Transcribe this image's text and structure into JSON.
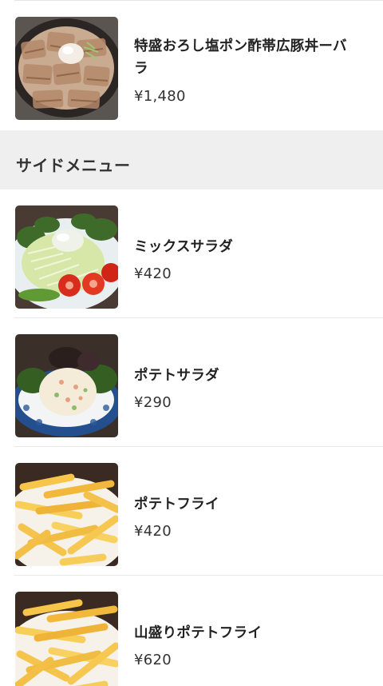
{
  "items_top": [
    {
      "name": "特盛おろし塩ポン酢帯広豚丼ーバラ",
      "price": "¥1,480",
      "image": "pork-bowl"
    }
  ],
  "section": {
    "title": "サイドメニュー"
  },
  "items": [
    {
      "name": "ミックスサラダ",
      "price": "¥420",
      "image": "mixed-salad"
    },
    {
      "name": "ポテトサラダ",
      "price": "¥290",
      "image": "potato-salad"
    },
    {
      "name": "ポテトフライ",
      "price": "¥420",
      "image": "french-fries"
    },
    {
      "name": "山盛りポテトフライ",
      "price": "¥620",
      "image": "large-french-fries"
    }
  ]
}
